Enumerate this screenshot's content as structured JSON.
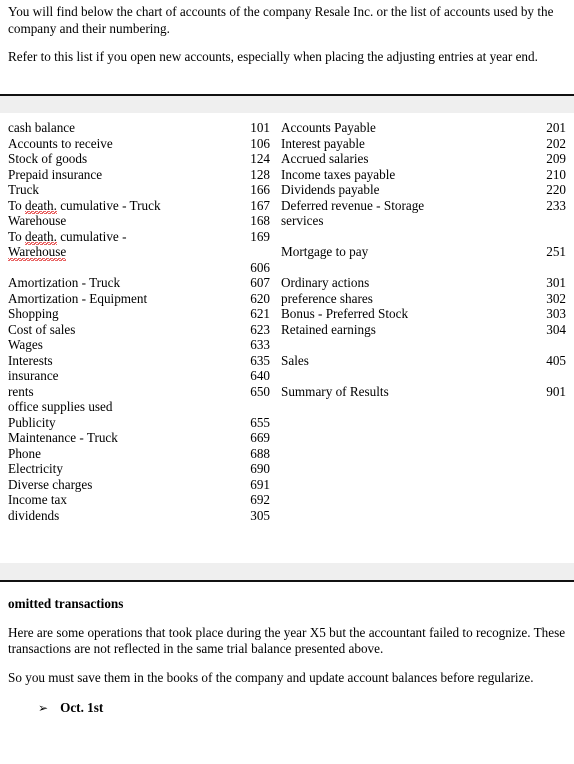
{
  "intro": {
    "paragraph_1": "You will find below the chart of accounts of the company Resale Inc. or the list of accounts used by the company and their numbering.",
    "paragraph_2": "Refer to this list if you open new accounts, especially when placing the adjusting entries at year end."
  },
  "chart_of_accounts": {
    "left_column": [
      {
        "name": "cash balance",
        "number": "101"
      },
      {
        "name": "Accounts to receive",
        "number": "106"
      },
      {
        "name": "Stock of goods",
        "number": "124"
      },
      {
        "name": "Prepaid insurance",
        "number": "128"
      },
      {
        "name": "Truck",
        "number": "166"
      },
      {
        "name": "To death. cumulative - Truck",
        "number": "167",
        "misspelled": "death."
      },
      {
        "name": "Warehouse",
        "number": "168"
      },
      {
        "name": "To death. cumulative -",
        "number": "169",
        "misspelled": "death."
      },
      {
        "name": "Warehouse",
        "number": "",
        "misspelled": "Warehouse",
        "underlined": true
      },
      {
        "name": "",
        "number": "606"
      },
      {
        "name": "Amortization - Truck",
        "number": "607"
      },
      {
        "name": "Amortization - Equipment",
        "number": "620"
      },
      {
        "name": "Shopping",
        "number": "621"
      },
      {
        "name": "Cost of sales",
        "number": "623"
      },
      {
        "name": "Wages",
        "number": "633"
      },
      {
        "name": "Interests",
        "number": "635"
      },
      {
        "name": "insurance",
        "number": "640"
      },
      {
        "name": "rents",
        "number": "650"
      },
      {
        "name": "office supplies used",
        "number": ""
      },
      {
        "name": "Publicity",
        "number": "655"
      },
      {
        "name": "Maintenance - Truck",
        "number": "669"
      },
      {
        "name": "Phone",
        "number": "688"
      },
      {
        "name": "Electricity",
        "number": "690"
      },
      {
        "name": "Diverse charges",
        "number": "691"
      },
      {
        "name": "Income tax",
        "number": "692"
      },
      {
        "name": "dividends",
        "number": "305"
      }
    ],
    "right_column": [
      {
        "name": "Accounts Payable",
        "number": "201"
      },
      {
        "name": "Interest payable",
        "number": "202"
      },
      {
        "name": "Accrued salaries",
        "number": "209"
      },
      {
        "name": "Income taxes payable",
        "number": "210"
      },
      {
        "name": "Dividends payable",
        "number": "220"
      },
      {
        "name": "Deferred revenue - Storage",
        "number": "233"
      },
      {
        "name": "services",
        "number": ""
      },
      {
        "name": "",
        "number": ""
      },
      {
        "name": "Mortgage to pay",
        "number": "251"
      },
      {
        "name": "",
        "number": ""
      },
      {
        "name": "Ordinary actions",
        "number": "301"
      },
      {
        "name": "preference shares",
        "number": "302"
      },
      {
        "name": "Bonus - Preferred Stock",
        "number": "303"
      },
      {
        "name": "Retained earnings",
        "number": "304"
      },
      {
        "name": "",
        "number": ""
      },
      {
        "name": "Sales",
        "number": "405"
      },
      {
        "name": "",
        "number": ""
      },
      {
        "name": "Summary of Results",
        "number": "901"
      }
    ]
  },
  "bottom_section": {
    "heading": "omitted transactions",
    "paragraph_1": "Here are some operations that took place during the year X5 but the accountant failed to recognize. These transactions are not reflected in the same trial balance presented above.",
    "paragraph_2": "So you must save them in the books of the company and update account balances before regularize.",
    "bullet_glyph": "➢",
    "bullet_label": "Oct. 1st"
  },
  "colors": {
    "text": "#000000",
    "rule": "#111111",
    "band": "#efefef",
    "spellcheck": "#e03131"
  }
}
